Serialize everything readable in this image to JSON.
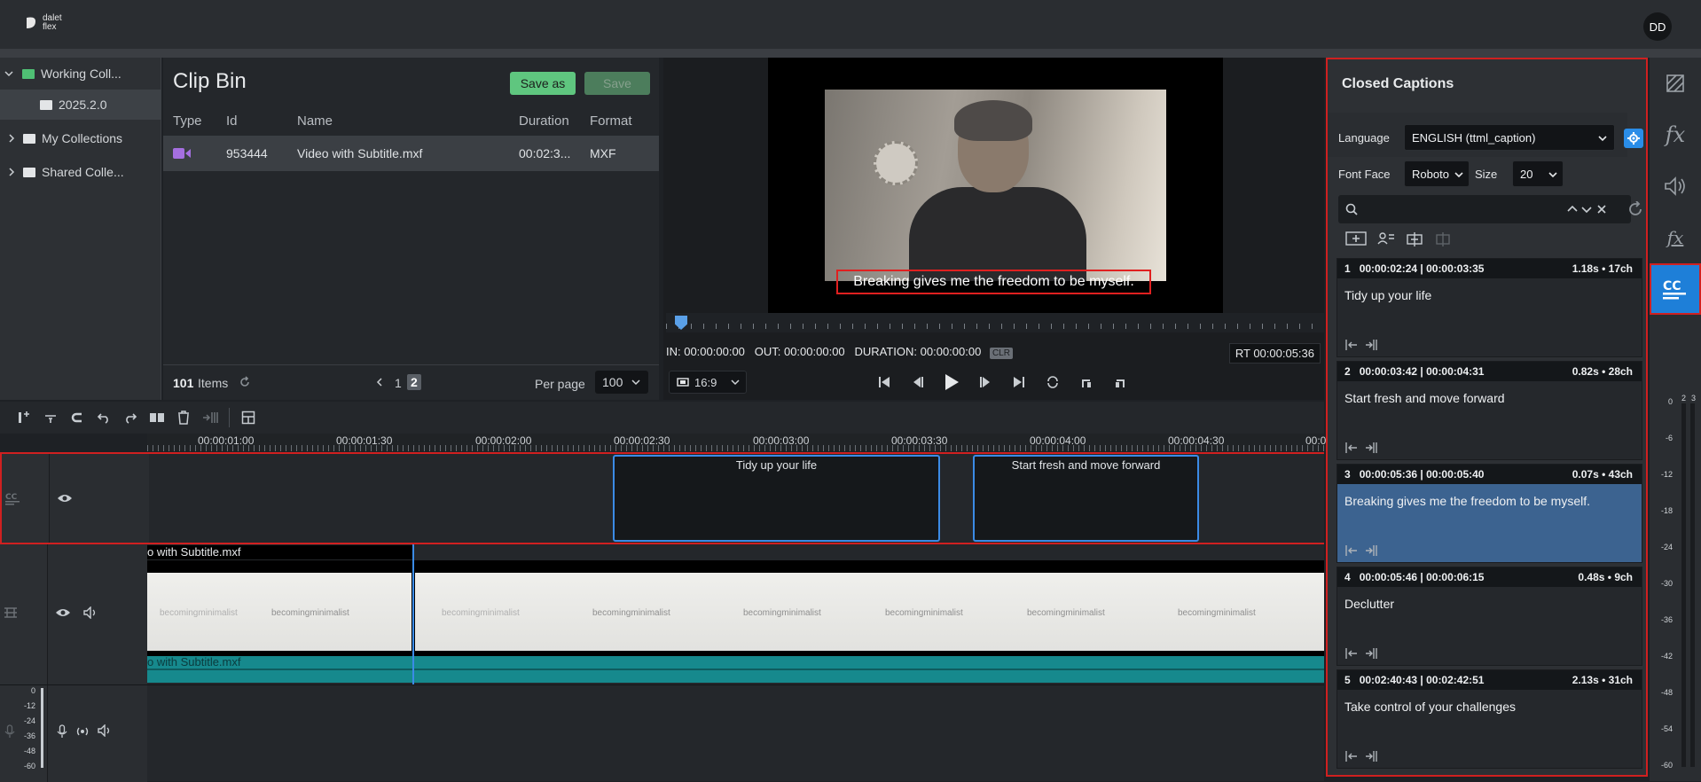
{
  "app": {
    "logo_line1": "dalet",
    "logo_line2": "flex",
    "user_initials": "DD"
  },
  "tree": {
    "items": [
      {
        "label": "Working Coll..."
      },
      {
        "label": "2025.2.0"
      },
      {
        "label": "My Collections"
      },
      {
        "label": "Shared Colle..."
      }
    ]
  },
  "clip_bin": {
    "title": "Clip Bin",
    "save_as": "Save as",
    "save": "Save",
    "columns": [
      "Type",
      "Id",
      "Name",
      "Duration",
      "Format"
    ],
    "rows": [
      {
        "id": "953444",
        "name": "Video with Subtitle.mxf",
        "duration": "00:02:3...",
        "format": "MXF"
      }
    ],
    "count": "101",
    "count_label": "Items",
    "page_prev": "1",
    "page_current": "2",
    "per_page_label": "Per page",
    "per_page_value": "100"
  },
  "preview": {
    "subtitle": "Breaking gives me the freedom to be myself.",
    "in": "IN: 00:00:00:00",
    "out": "OUT: 00:00:00:00",
    "duration": "DURATION: 00:00:00:00",
    "clr": "CLR",
    "rt": "RT 00:00:05:36",
    "ratio": "16:9"
  },
  "timeline": {
    "ruler": [
      "00:00:01:00",
      "00:00:01:30",
      "00:00:02:00",
      "00:00:02:30",
      "00:00:03:00",
      "00:00:03:30",
      "00:00:04:00",
      "00:00:04:30",
      "00:0"
    ],
    "cc_clips": [
      "Tidy up your life",
      "Start fresh and move forward"
    ],
    "video_label": "o with Subtitle.mxf",
    "audio_label": "o with Subtitle.mxf",
    "thumb_logo": "becomingminimalist",
    "meter": [
      "0",
      "-12",
      "-24",
      "-36",
      "-48",
      "-60"
    ]
  },
  "captions_panel": {
    "title": "Closed Captions",
    "language_label": "Language",
    "language_value": "ENGLISH (ttml_caption)",
    "font_label": "Font Face",
    "font_value": "Roboto",
    "size_label": "Size",
    "size_value": "20",
    "items": [
      {
        "num": "1",
        "times": "00:00:02:24 | 00:00:03:35",
        "stats": "1.18s • 17ch",
        "text": "Tidy up your life"
      },
      {
        "num": "2",
        "times": "00:00:03:42 | 00:00:04:31",
        "stats": "0.82s • 28ch",
        "text": "Start fresh and move forward"
      },
      {
        "num": "3",
        "times": "00:00:05:36 | 00:00:05:40",
        "stats": "0.07s • 43ch",
        "text": "Breaking gives me the freedom to be myself."
      },
      {
        "num": "4",
        "times": "00:00:05:46 | 00:00:06:15",
        "stats": "0.48s • 9ch",
        "text": "Declutter"
      },
      {
        "num": "5",
        "times": "00:02:40:43 | 00:02:42:51",
        "stats": "2.13s • 31ch",
        "text": "Take control of your challenges"
      }
    ]
  },
  "sidebar": {
    "fx1": "fx",
    "fx2": "fx",
    "vu_channels": [
      "2",
      "3"
    ],
    "vu_scale": [
      "0",
      "-6",
      "-12",
      "-18",
      "-24",
      "-30",
      "-36",
      "-42",
      "-48",
      "-54",
      "-60"
    ]
  }
}
